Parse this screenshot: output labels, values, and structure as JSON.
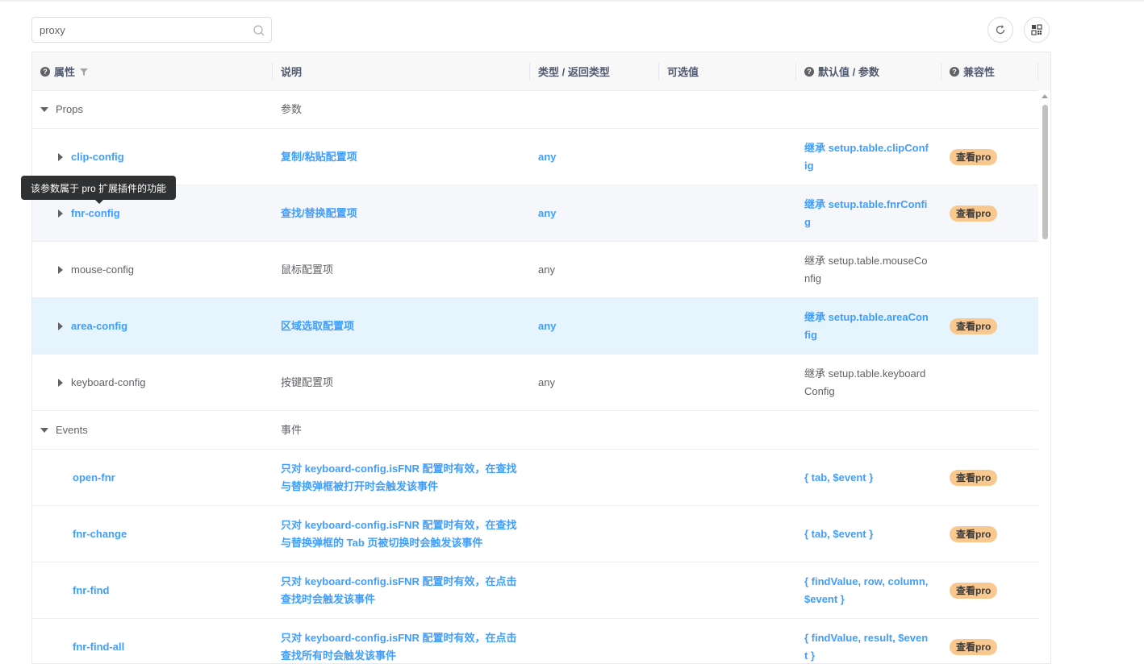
{
  "search": {
    "value": "proxy",
    "placeholder": ""
  },
  "toolbar": {
    "refresh_icon": "refresh-icon",
    "layout_icon": "grid-layout-icon"
  },
  "table": {
    "columns": {
      "attr": "属性",
      "desc": "说明",
      "type": "类型 / 返回类型",
      "options": "可选值",
      "default": "默认值 / 参数",
      "compat": "兼容性"
    },
    "rows": [
      {
        "kind": "group",
        "name": "Props",
        "desc": "参数"
      },
      {
        "kind": "item",
        "name": "clip-config",
        "desc": "复制/粘贴配置项",
        "type": "any",
        "options": "",
        "default": "继承 setup.table.clipConfig",
        "compat": "查看pro",
        "pro": true,
        "expandable": true
      },
      {
        "kind": "item",
        "name": "fnr-config",
        "desc": "查找/替换配置项",
        "type": "any",
        "options": "",
        "default": "继承 setup.table.fnrConfig",
        "compat": "查看pro",
        "pro": true,
        "expandable": true,
        "state": "hover"
      },
      {
        "kind": "item",
        "name": "mouse-config",
        "desc": "鼠标配置项",
        "type": "any",
        "options": "",
        "default": "继承 setup.table.mouseConfig",
        "compat": "",
        "pro": false,
        "expandable": true
      },
      {
        "kind": "item",
        "name": "area-config",
        "desc": "区域选取配置项",
        "type": "any",
        "options": "",
        "default": "继承 setup.table.areaConfig",
        "compat": "查看pro",
        "pro": true,
        "expandable": true,
        "state": "current"
      },
      {
        "kind": "item",
        "name": "keyboard-config",
        "desc": "按键配置项",
        "type": "any",
        "options": "",
        "default": "继承 setup.table.keyboardConfig",
        "compat": "",
        "pro": false,
        "expandable": true
      },
      {
        "kind": "group",
        "name": "Events",
        "desc": "事件"
      },
      {
        "kind": "item",
        "name": "open-fnr",
        "desc": "只对 keyboard-config.isFNR 配置时有效，在查找与替换弹框被打开时会触发该事件",
        "type": "",
        "options": "",
        "default": "{ tab, $event }",
        "compat": "查看pro",
        "pro": true,
        "expandable": false
      },
      {
        "kind": "item",
        "name": "fnr-change",
        "desc": "只对 keyboard-config.isFNR 配置时有效，在查找与替换弹框的 Tab 页被切换时会触发该事件",
        "type": "",
        "options": "",
        "default": "{ tab, $event }",
        "compat": "查看pro",
        "pro": true,
        "expandable": false
      },
      {
        "kind": "item",
        "name": "fnr-find",
        "desc": "只对 keyboard-config.isFNR 配置时有效，在点击查找时会触发该事件",
        "type": "",
        "options": "",
        "default": "{ findValue, row, column, $event }",
        "compat": "查看pro",
        "pro": true,
        "expandable": false
      },
      {
        "kind": "item",
        "name": "fnr-find-all",
        "desc": "只对 keyboard-config.isFNR 配置时有效，在点击查找所有时会触发该事件",
        "type": "",
        "options": "",
        "default": "{ findValue, result, $event }",
        "compat": "查看pro",
        "pro": true,
        "expandable": false
      }
    ]
  },
  "tooltip": {
    "text": "该参数属于 pro 扩展插件的功能"
  },
  "colors": {
    "accent": "#409eff",
    "badge": "#f8c88f",
    "current_row": "#e6f4fd",
    "hover_row": "#f5f7fa"
  }
}
